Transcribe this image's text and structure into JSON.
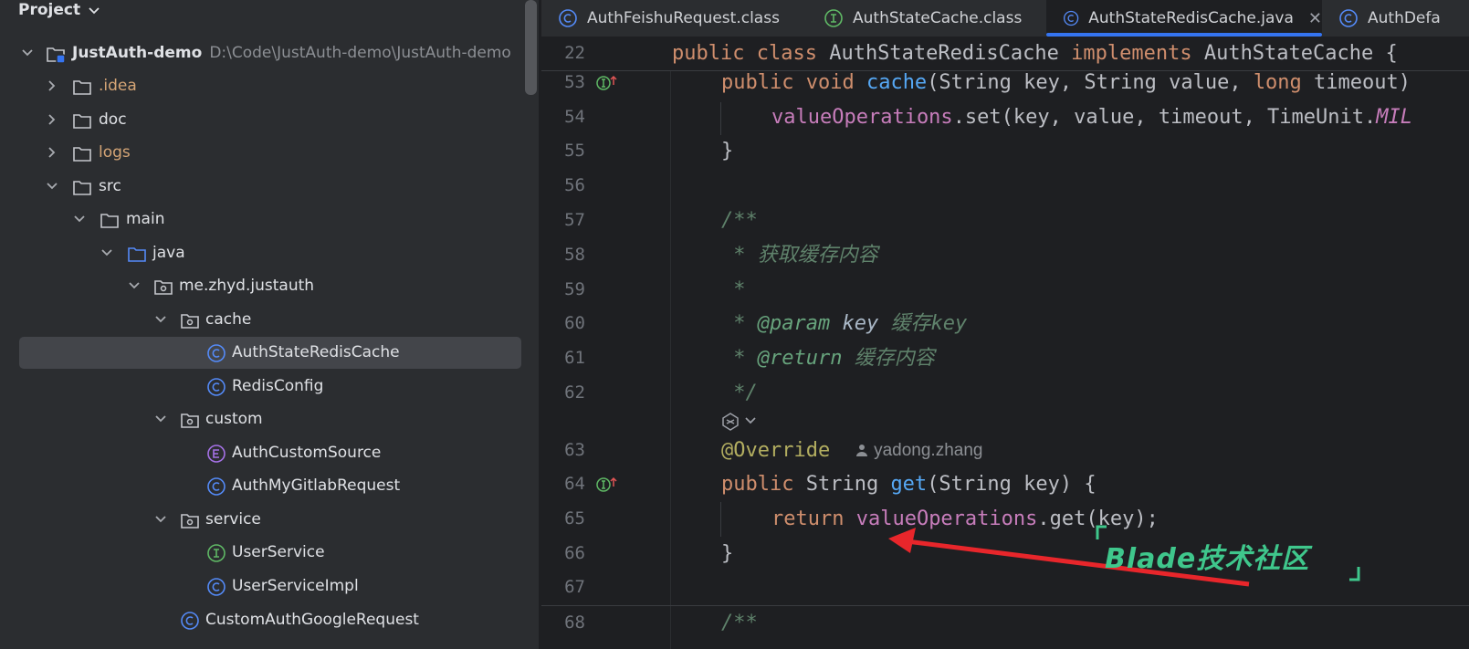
{
  "project_panel": {
    "title": "Project",
    "root": {
      "name": "JustAuth-demo",
      "path": "D:\\Code\\JustAuth-demo\\JustAuth-demo"
    },
    "items": [
      {
        "label": ".idea",
        "kind": "folder",
        "color": "orange"
      },
      {
        "label": "doc",
        "kind": "folder"
      },
      {
        "label": "logs",
        "kind": "folder",
        "color": "orange"
      },
      {
        "label": "src",
        "kind": "folder"
      },
      {
        "label": "main",
        "kind": "folder"
      },
      {
        "label": "java",
        "kind": "source-folder"
      },
      {
        "label": "me.zhyd.justauth",
        "kind": "package"
      },
      {
        "label": "cache",
        "kind": "package"
      },
      {
        "label": "AuthStateRedisCache",
        "kind": "class",
        "selected": true
      },
      {
        "label": "RedisConfig",
        "kind": "class"
      },
      {
        "label": "custom",
        "kind": "package"
      },
      {
        "label": "AuthCustomSource",
        "kind": "enum"
      },
      {
        "label": "AuthMyGitlabRequest",
        "kind": "class"
      },
      {
        "label": "service",
        "kind": "package"
      },
      {
        "label": "UserService",
        "kind": "interface"
      },
      {
        "label": "UserServiceImpl",
        "kind": "class"
      },
      {
        "label": "CustomAuthGoogleRequest",
        "kind": "class"
      }
    ]
  },
  "editor": {
    "tabs": [
      {
        "label": "AuthFeishuRequest.class",
        "icon": "class-icon"
      },
      {
        "label": "AuthStateCache.class",
        "icon": "interface-icon"
      },
      {
        "label": "AuthStateRedisCache.java",
        "icon": "class-icon",
        "active": true
      },
      {
        "label": "AuthDefa",
        "icon": "class-icon"
      }
    ],
    "sticky": {
      "num": "22",
      "parts": [
        "public",
        " class ",
        "AuthStateRedisCache",
        " implements ",
        "AuthStateCache {"
      ]
    },
    "lines": {
      "l53": {
        "num": "53",
        "t1": "public void ",
        "t2": "cache",
        "t3": "(String key, String value, ",
        "t4": "long",
        "t5": " timeout)"
      },
      "l54": {
        "num": "54",
        "t1": "valueOperations",
        "t2": ".set(key, value, timeout, TimeUnit.",
        "t3": "MIL"
      },
      "l55": {
        "num": "55",
        "t1": "}"
      },
      "l56": {
        "num": "56"
      },
      "l57": {
        "num": "57",
        "t1": "/**"
      },
      "l58": {
        "num": "58",
        "t1": " * 获取缓存内容"
      },
      "l59": {
        "num": "59",
        "t1": " *"
      },
      "l60": {
        "num": "60",
        "t1": " * ",
        "t2": "@param",
        "t3": " key",
        "t4": " 缓存key"
      },
      "l61": {
        "num": "61",
        "t1": " * ",
        "t2": "@return",
        "t3": " 缓存内容"
      },
      "l62": {
        "num": "62",
        "t1": " */"
      },
      "l63": {
        "num": "63",
        "t1": "@Override",
        "author": "yadong.zhang"
      },
      "l64": {
        "num": "64",
        "t1": "public ",
        "t2": "String ",
        "t3": "get",
        "t4": "(String key) {"
      },
      "l65": {
        "num": "65",
        "t1": "return ",
        "t2": "valueOperations",
        "t3": ".get(key);"
      },
      "l66": {
        "num": "66",
        "t1": "}"
      },
      "l67": {
        "num": "67"
      },
      "l68": {
        "num": "68",
        "t1": "/**"
      }
    }
  },
  "watermark": {
    "text": "Blade技术社区",
    "color": "#3fc78c"
  },
  "colors": {
    "accent": "#3574f0",
    "arrow": "#e8262b"
  }
}
